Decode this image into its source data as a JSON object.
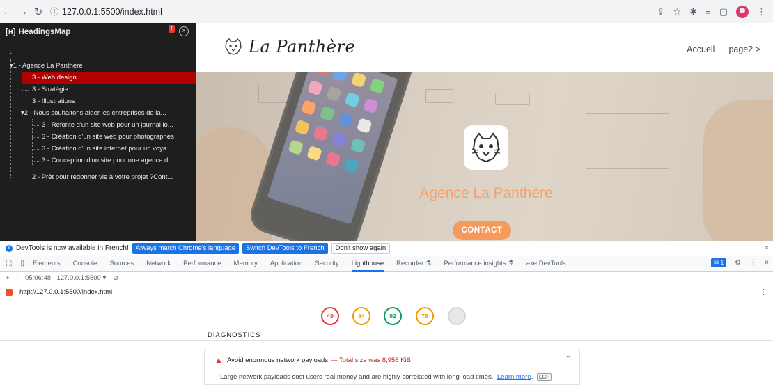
{
  "browser": {
    "url": "127.0.0.1:5500/index.html"
  },
  "headingsmap": {
    "title": "HeadingsMap",
    "items": [
      {
        "label": "1 - Agence La Panthère",
        "level": 1
      },
      {
        "label": "3 - Web design",
        "level": 3
      },
      {
        "label": "3 - Stratégie",
        "level": 3
      },
      {
        "label": "3 - Illustrations",
        "level": 3
      },
      {
        "label": "2 - Nous souhaitons aider les entreprises de la...",
        "level": 2
      },
      {
        "label": "3 - Refonte d'un site web pour un journal lo...",
        "level": 3
      },
      {
        "label": "3 - Création d'un site web pour photographes",
        "level": 3
      },
      {
        "label": "3 - Création d'un site internet pour un voya...",
        "level": 3
      },
      {
        "label": "3 - Conception d'un site pour une agence d...",
        "level": 3
      },
      {
        "label": "2 - Prêt pour redonner vie à votre projet ?Cont...",
        "level": 2
      }
    ]
  },
  "site": {
    "brand": "La Panthère",
    "nav": [
      "Accueil",
      "page2 >"
    ],
    "hero_title": "Agence La Panthère",
    "cta": "CONTACT"
  },
  "devtools": {
    "banner": {
      "text": "DevTools is now available in French!",
      "btn_match": "Always match Chrome's language",
      "btn_switch": "Switch DevTools to French",
      "btn_dismiss": "Don't show again"
    },
    "tabs": [
      "Elements",
      "Console",
      "Sources",
      "Network",
      "Performance",
      "Memory",
      "Application",
      "Security",
      "Lighthouse",
      "Recorder ⚗",
      "Performance insights ⚗",
      "axe DevTools"
    ],
    "active_tab": "Lighthouse",
    "issues_count": "1",
    "report_time": "05:06:48 - 127.0.0.1:5500",
    "report_url": "http://127.0.0.1:5500/index.html",
    "scores": [
      {
        "value": "49",
        "color": "#e53935"
      },
      {
        "value": "84",
        "color": "#f29900"
      },
      {
        "value": "92",
        "color": "#0f9d58"
      },
      {
        "value": "78",
        "color": "#f29900"
      },
      {
        "value": "",
        "color": "#bdbdbd"
      }
    ],
    "diagnostics_title": "DIAGNOSTICS",
    "audit": {
      "title": "Avoid enormous network payloads",
      "detail": "— Total size was 8,956 KiB",
      "description": "Large network payloads cost users real money and are highly correlated with long load times.",
      "learn_more": "Learn more",
      "tag": "LCP"
    }
  }
}
